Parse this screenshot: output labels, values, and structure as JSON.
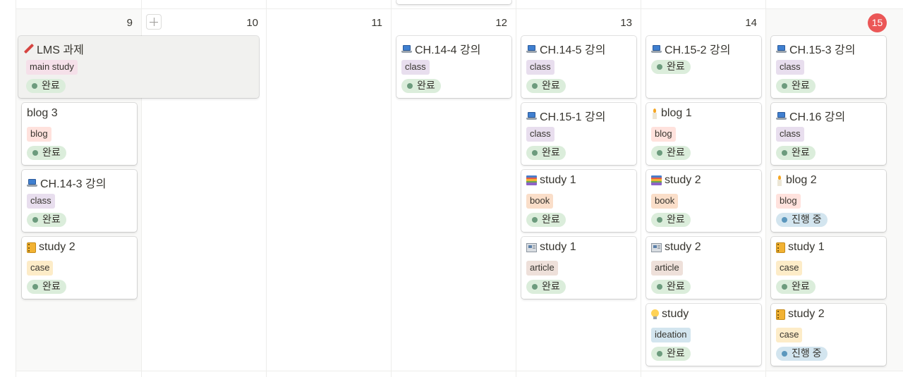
{
  "calendar": {
    "day_numbers": [
      "9",
      "10",
      "11",
      "12",
      "13",
      "14"
    ],
    "today": "15",
    "add_label": "+"
  },
  "colors": {
    "tag_main_study": "#f5e0e9",
    "tag_class": "#e8deee",
    "tag_blog": "#ffe2dd",
    "tag_book": "#fadec9",
    "tag_case": "#fdecc8",
    "tag_article": "#eee0da",
    "tag_ideation": "#d3e5ef",
    "status_done_bg": "#dbeddb",
    "status_done_dot": "#6c9b7d",
    "status_progress_bg": "#d3e5ef",
    "status_progress_dot": "#5b97bd",
    "today_badge": "#eb5757"
  },
  "cards": {
    "lms": {
      "icon": "pencil-icon",
      "title": "LMS 과제",
      "tag": "main study",
      "status": "완료"
    },
    "blog3": {
      "title": "blog 3",
      "tag": "blog",
      "status": "완료"
    },
    "ch14_3": {
      "icon": "laptop-icon",
      "title": "CH.14-3 강의",
      "tag": "class",
      "status": "완료"
    },
    "study2_case_9": {
      "icon": "notebook-icon",
      "title": "study 2",
      "tag": "case",
      "status": "완료"
    },
    "ch14_4": {
      "icon": "laptop-icon",
      "title": "CH.14-4 강의",
      "tag": "class",
      "status": "완료"
    },
    "ch14_5": {
      "icon": "laptop-icon",
      "title": "CH.14-5 강의",
      "tag": "class",
      "status": "완료"
    },
    "ch15_1": {
      "icon": "laptop-icon",
      "title": "CH.15-1 강의",
      "tag": "class",
      "status": "완료"
    },
    "study1_book": {
      "icon": "books-icon",
      "title": "study 1",
      "tag": "book",
      "status": "완료"
    },
    "study1_article": {
      "icon": "newspaper-icon",
      "title": "study 1",
      "tag": "article",
      "status": "완료"
    },
    "ch15_2": {
      "icon": "laptop-icon",
      "title": "CH.15-2 강의",
      "status": "완료"
    },
    "blog1": {
      "icon": "candle-icon",
      "title": "blog 1",
      "tag": "blog",
      "status": "완료"
    },
    "study2_book": {
      "icon": "books-icon",
      "title": "study 2",
      "tag": "book",
      "status": "완료"
    },
    "study2_article": {
      "icon": "newspaper-icon",
      "title": "study 2",
      "tag": "article",
      "status": "완료"
    },
    "study_ideation": {
      "icon": "bulb-icon",
      "title": "study",
      "tag": "ideation",
      "status": "완료"
    },
    "ch15_3": {
      "icon": "laptop-icon",
      "title": "CH.15-3 강의",
      "tag": "class",
      "status": "완료"
    },
    "ch16": {
      "icon": "laptop-icon",
      "title": "CH.16 강의",
      "tag": "class",
      "status": "완료"
    },
    "blog2": {
      "icon": "candle-icon",
      "title": "blog 2",
      "tag": "blog",
      "status": "진행 중"
    },
    "study1_case_15": {
      "icon": "notebook-icon",
      "title": "study 1",
      "tag": "case",
      "status": "완료"
    },
    "study2_case_15": {
      "icon": "notebook-icon",
      "title": "study 2",
      "tag": "case",
      "status": "진행 중"
    }
  }
}
